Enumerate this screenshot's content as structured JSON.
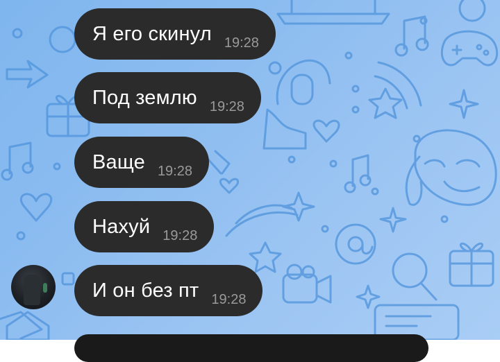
{
  "chat": {
    "messages": [
      {
        "text": "Я его скинул",
        "time": "19:28"
      },
      {
        "text": "Под землю",
        "time": "19:28"
      },
      {
        "text": "Ваще",
        "time": "19:28"
      },
      {
        "text": "Нахуй",
        "time": "19:28"
      },
      {
        "text": "И он без пт",
        "time": "19:28"
      }
    ]
  },
  "colors": {
    "bubble": "#2b2b2b",
    "text": "#ffffff",
    "time": "#9a9a9a",
    "background": "#8cbcf0",
    "pattern": "#4f93db"
  }
}
